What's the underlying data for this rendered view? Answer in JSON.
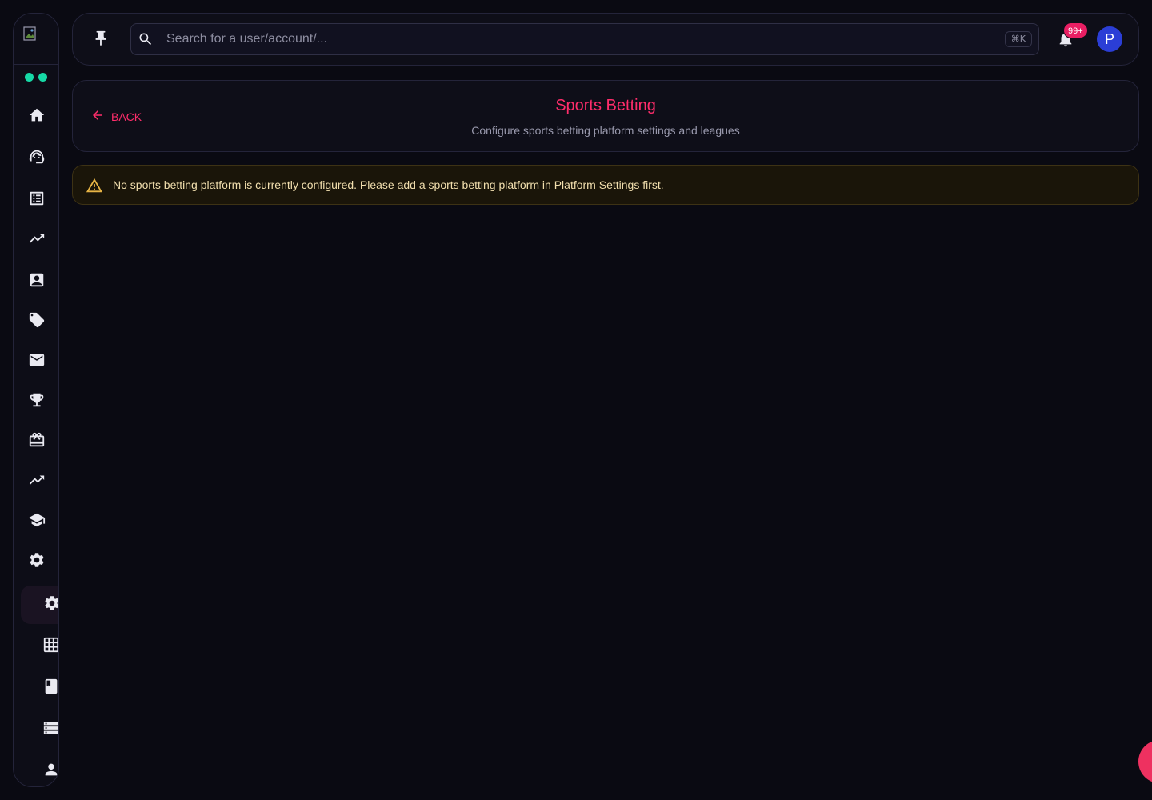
{
  "topbar": {
    "search_placeholder": "Search for a user/account/...",
    "search_shortcut": "⌘K",
    "notification_count": "99+",
    "avatar_initial": "P"
  },
  "header": {
    "back_label": "BACK",
    "title": "Sports Betting",
    "subtitle": "Configure sports betting platform settings and leagues"
  },
  "alert": {
    "message": "No sports betting platform is currently configured. Please add a sports betting platform in Platform Settings first."
  },
  "sidebar": {
    "status_dots": 2,
    "items": [
      {
        "icon": "home-icon"
      },
      {
        "icon": "support-agent-icon"
      },
      {
        "icon": "list-alt-icon"
      },
      {
        "icon": "trending-up-icon"
      },
      {
        "icon": "contact-card-icon"
      },
      {
        "icon": "tag-icon"
      },
      {
        "icon": "mail-icon"
      },
      {
        "icon": "trophy-icon"
      },
      {
        "icon": "gift-card-icon"
      },
      {
        "icon": "trending-up-icon"
      },
      {
        "icon": "school-icon"
      },
      {
        "icon": "settings-icon"
      },
      {
        "icon": "settings-icon",
        "active": true
      },
      {
        "icon": "grid-icon"
      },
      {
        "icon": "book-icon"
      },
      {
        "icon": "storage-icon"
      },
      {
        "icon": "person-icon"
      }
    ]
  },
  "colors": {
    "accent": "#ff2d6b",
    "status_online": "#16d9a6",
    "avatar": "#2b3ed6",
    "warning": "#e6b445",
    "badge": "#e91e63"
  }
}
